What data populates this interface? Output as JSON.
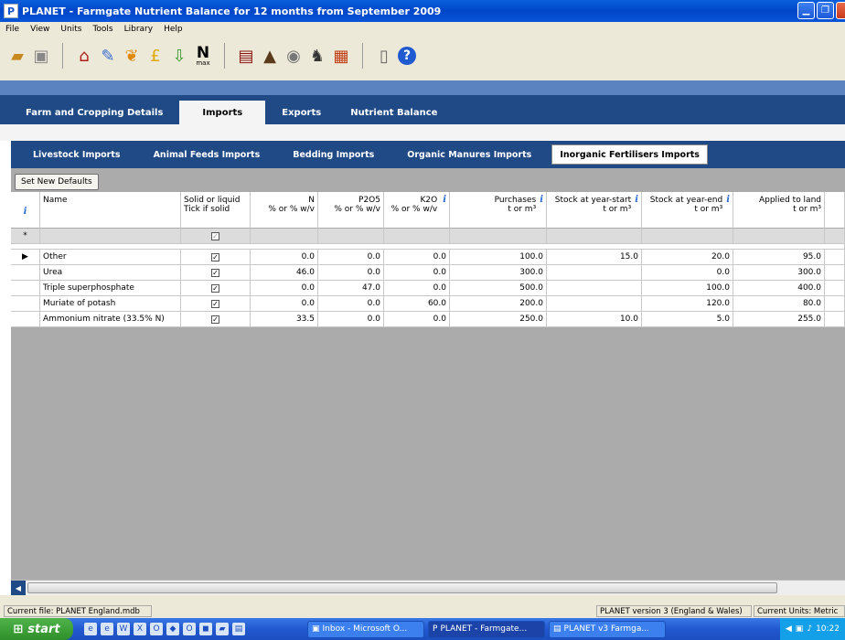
{
  "window": {
    "title": "PLANET - Farmgate Nutrient Balance for 12 months from September 2009",
    "app_icon": "P"
  },
  "menu": [
    "File",
    "View",
    "Units",
    "Tools",
    "Library",
    "Help"
  ],
  "toolbar": {
    "max_label": "max",
    "n_label": "N"
  },
  "main_tabs": [
    "Farm and Cropping Details",
    "Imports",
    "Exports",
    "Nutrient Balance"
  ],
  "sub_tabs": [
    "Livestock Imports",
    "Animal Feeds Imports",
    "Bedding Imports",
    "Organic Manures Imports",
    "Inorganic Fertilisers Imports"
  ],
  "set_defaults_label": "Set New Defaults",
  "grid": {
    "headers": {
      "name": "Name",
      "solid_1": "Solid or liquid",
      "solid_2": "Tick if solid",
      "n_1": "N",
      "n_2": "% or % w/v",
      "p_1": "P2O5",
      "p_2": "% or % w/v",
      "k_1": "K2O",
      "k_2": "% or % w/v",
      "purch_1": "Purchases",
      "purch_2": "t or m³",
      "start_1": "Stock at year-start",
      "start_2": "t or m³",
      "end_1": "Stock at year-end",
      "end_2": "t or m³",
      "applied_1": "Applied to land",
      "applied_2": "t or m³"
    },
    "info_glyph": "i",
    "new_row_marker": "*",
    "current_row_marker": "▶",
    "rows": [
      {
        "name": "Other",
        "n": "0.0",
        "p": "0.0",
        "k": "0.0",
        "purchases": "100.0",
        "start": "15.0",
        "end": "20.0",
        "applied": "95.0"
      },
      {
        "name": "Urea",
        "n": "46.0",
        "p": "0.0",
        "k": "0.0",
        "purchases": "300.0",
        "start": "",
        "end": "0.0",
        "applied": "300.0"
      },
      {
        "name": "Triple superphosphate",
        "n": "0.0",
        "p": "47.0",
        "k": "0.0",
        "purchases": "500.0",
        "start": "",
        "end": "100.0",
        "applied": "400.0"
      },
      {
        "name": "Muriate of potash",
        "n": "0.0",
        "p": "0.0",
        "k": "60.0",
        "purchases": "200.0",
        "start": "",
        "end": "120.0",
        "applied": "80.0"
      },
      {
        "name": "Ammonium nitrate (33.5% N)",
        "n": "33.5",
        "p": "0.0",
        "k": "0.0",
        "purchases": "250.0",
        "start": "10.0",
        "end": "5.0",
        "applied": "255.0"
      }
    ]
  },
  "status": {
    "file": "Current file: PLANET England.mdb",
    "version": "PLANET version 3 (England & Wales)",
    "units": "Current Units: Metric"
  },
  "taskbar": {
    "start": "start",
    "tasks": [
      "Inbox - Microsoft O...",
      "PLANET - Farmgate...",
      "PLANET v3 Farmga..."
    ],
    "clock": "10:22"
  }
}
